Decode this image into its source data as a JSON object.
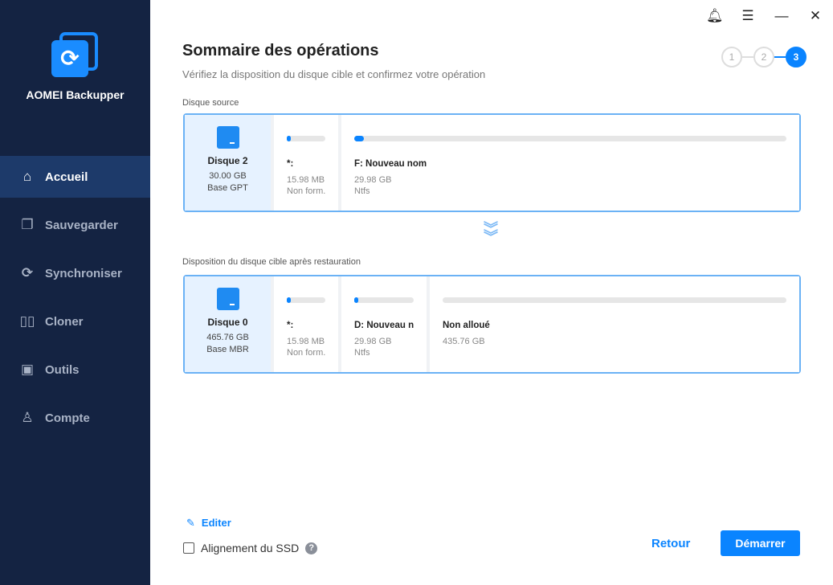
{
  "app": {
    "name": "AOMEI Backupper"
  },
  "nav": [
    {
      "label": "Accueil",
      "icon": "home-icon"
    },
    {
      "label": "Sauvegarder",
      "icon": "backup-icon"
    },
    {
      "label": "Synchroniser",
      "icon": "sync-icon"
    },
    {
      "label": "Cloner",
      "icon": "clone-icon"
    },
    {
      "label": "Outils",
      "icon": "tools-icon"
    },
    {
      "label": "Compte",
      "icon": "account-icon"
    }
  ],
  "header": {
    "title": "Sommaire des opérations",
    "subtitle": "Vérifiez la disposition du disque cible et confirmez votre opération",
    "steps": [
      "1",
      "2",
      "3"
    ],
    "active_step": 3
  },
  "source": {
    "label": "Disque source",
    "disk": {
      "name": "Disque 2",
      "size": "30.00 GB",
      "type": "Base GPT"
    },
    "partitions": [
      {
        "name": "*:",
        "size": "15.98 MB",
        "fs": "Non form...",
        "used_pct": 5
      },
      {
        "name": "F: Nouveau nom",
        "size": "29.98 GB",
        "fs": "Ntfs",
        "used_pct": 2
      }
    ]
  },
  "target": {
    "label": "Disposition du disque cible après restauration",
    "disk": {
      "name": "Disque 0",
      "size": "465.76 GB",
      "type": "Base MBR"
    },
    "partitions": [
      {
        "name": "*:",
        "size": "15.98 MB",
        "fs": "Non form...",
        "used_pct": 5
      },
      {
        "name": "D: Nouveau n...",
        "size": "29.98 GB",
        "fs": "Ntfs",
        "used_pct": 5
      },
      {
        "name": "Non alloué",
        "size": "435.76 GB",
        "fs": "",
        "used_pct": 0
      }
    ]
  },
  "footer": {
    "edit": "Editer",
    "ssd": "Alignement du SSD",
    "ssd_help": "?",
    "back": "Retour",
    "start": "Démarrer"
  },
  "colors": {
    "accent": "#0a84ff",
    "sidebar": "#142342"
  }
}
